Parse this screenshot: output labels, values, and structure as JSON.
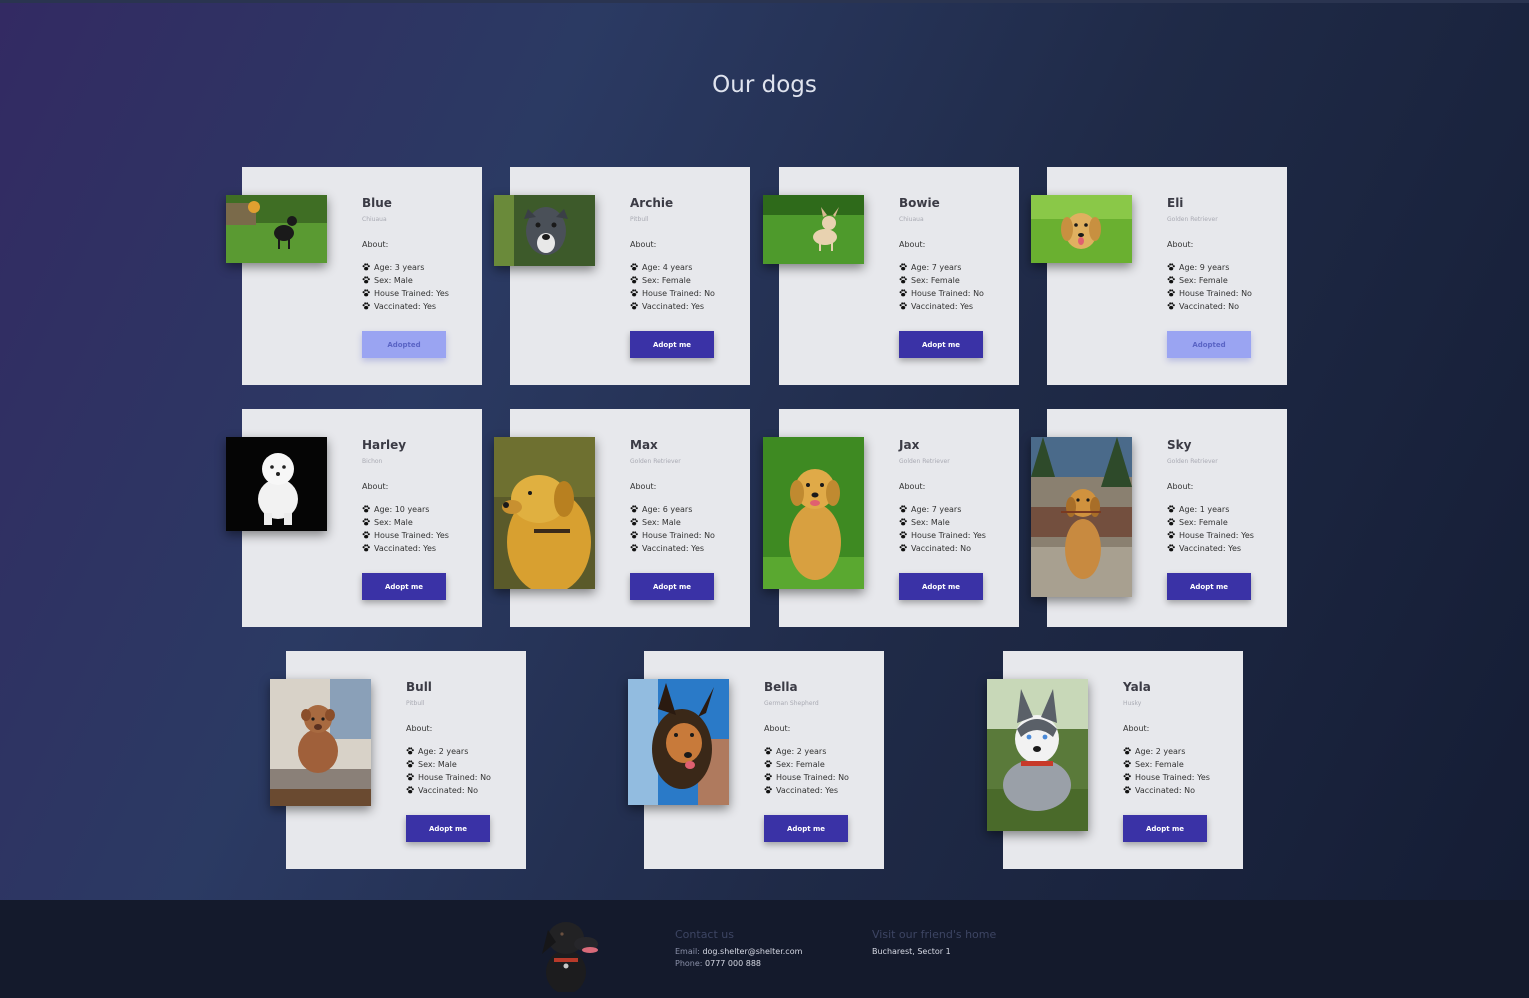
{
  "page": {
    "title": "Our dogs"
  },
  "labels": {
    "about": "About:",
    "age": "Age:",
    "sex": "Sex:",
    "house_trained": "House Trained:",
    "vaccinated": "Vaccinated:"
  },
  "colors": {
    "accent": "#3a32a6",
    "adopted": "#9aa4f2",
    "card": "#e7e8ec",
    "footer": "#141a2c"
  },
  "dogs": [
    {
      "name": "Blue",
      "breed": "Chiuaua",
      "age": "3 years",
      "sex": "Male",
      "house_trained": "Yes",
      "vaccinated": "Yes",
      "button": "Adopted",
      "adopted": true
    },
    {
      "name": "Archie",
      "breed": "Pitbull",
      "age": "4 years",
      "sex": "Female",
      "house_trained": "No",
      "vaccinated": "Yes",
      "button": "Adopt me",
      "adopted": false
    },
    {
      "name": "Bowie",
      "breed": "Chiuaua",
      "age": "7 years",
      "sex": "Female",
      "house_trained": "No",
      "vaccinated": "Yes",
      "button": "Adopt me",
      "adopted": false
    },
    {
      "name": "Eli",
      "breed": "Golden Retriever",
      "age": "9 years",
      "sex": "Female",
      "house_trained": "No",
      "vaccinated": "No",
      "button": "Adopted",
      "adopted": true
    },
    {
      "name": "Harley",
      "breed": "Bichon",
      "age": "10 years",
      "sex": "Male",
      "house_trained": "Yes",
      "vaccinated": "Yes",
      "button": "Adopt me",
      "adopted": false
    },
    {
      "name": "Max",
      "breed": "Golden Retriever",
      "age": "6 years",
      "sex": "Male",
      "house_trained": "No",
      "vaccinated": "Yes",
      "button": "Adopt me",
      "adopted": false
    },
    {
      "name": "Jax",
      "breed": "Golden Retriever",
      "age": "7 years",
      "sex": "Male",
      "house_trained": "Yes",
      "vaccinated": "No",
      "button": "Adopt me",
      "adopted": false
    },
    {
      "name": "Sky",
      "breed": "Golden Retriever",
      "age": "1 years",
      "sex": "Female",
      "house_trained": "Yes",
      "vaccinated": "Yes",
      "button": "Adopt me",
      "adopted": false
    },
    {
      "name": "Bull",
      "breed": "Pitbull",
      "age": "2 years",
      "sex": "Male",
      "house_trained": "No",
      "vaccinated": "No",
      "button": "Adopt me",
      "adopted": false
    },
    {
      "name": "Bella",
      "breed": "German Shepherd",
      "age": "2 years",
      "sex": "Female",
      "house_trained": "No",
      "vaccinated": "Yes",
      "button": "Adopt me",
      "adopted": false
    },
    {
      "name": "Yala",
      "breed": "Husky",
      "age": "2 years",
      "sex": "Female",
      "house_trained": "Yes",
      "vaccinated": "No",
      "button": "Adopt me",
      "adopted": false
    }
  ],
  "footer": {
    "contact_heading": "Contact us",
    "email_label": "Email:",
    "email": "dog.shelter@shelter.com",
    "phone_label": "Phone:",
    "phone": "0777 000 888",
    "visit_heading": "Visit our friend's home",
    "address": "Bucharest, Sector 1"
  }
}
